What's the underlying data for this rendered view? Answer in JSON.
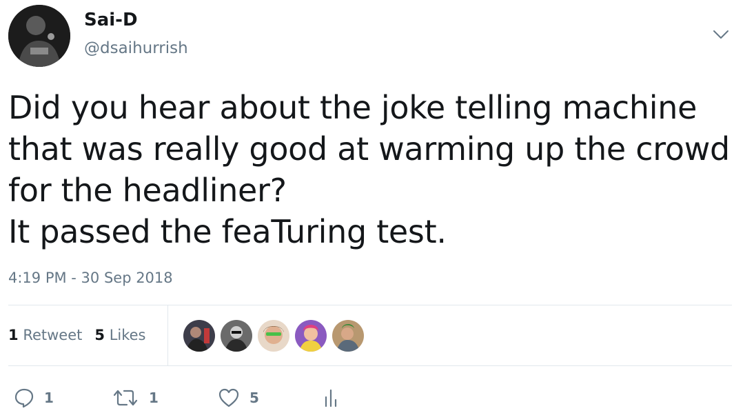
{
  "author": {
    "display_name": "Sai-D",
    "handle": "@dsaihurrish"
  },
  "tweet": {
    "lines": [
      "Did you hear about the joke telling machine",
      "that was really good at warming up the crowd",
      "for the headliner?",
      "It passed the feaTuring test."
    ],
    "timestamp": "4:19 PM - 30 Sep 2018"
  },
  "stats": {
    "retweets_count": "1",
    "retweets_label": "Retweet",
    "likes_count": "5",
    "likes_label": "Likes"
  },
  "likers": [
    "liker-avatar-1",
    "liker-avatar-2",
    "liker-avatar-3",
    "liker-avatar-4",
    "liker-avatar-5"
  ],
  "actions": {
    "reply_count": "1",
    "retweet_count": "1",
    "like_count": "5"
  },
  "colors": {
    "text": "#14171a",
    "secondary": "#657786",
    "divider": "#e1e8ed"
  },
  "icons": {
    "menu": "chevron-down-icon",
    "reply": "reply-icon",
    "retweet": "retweet-icon",
    "like": "heart-icon",
    "analytics": "analytics-icon"
  }
}
